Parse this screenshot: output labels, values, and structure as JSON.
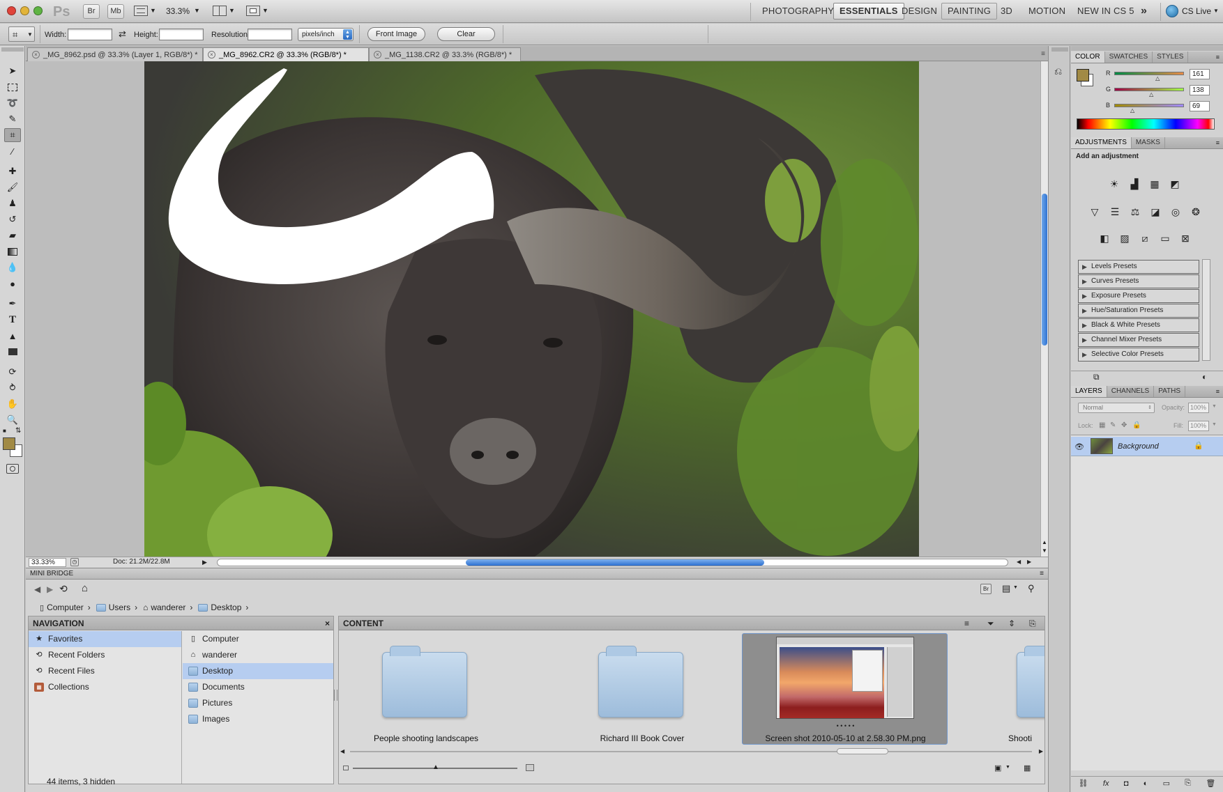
{
  "app": {
    "logo": "Ps",
    "bridge_btn": "Br",
    "minibridge_btn": "Mb",
    "zoom_menu": "33.3%",
    "workspaces": [
      "PHOTOGRAPHY",
      "ESSENTIALS",
      "DESIGN",
      "PAINTING",
      "3D",
      "MOTION",
      "NEW IN CS 5"
    ],
    "active_workspace": "ESSENTIALS",
    "more_glyph": "»",
    "cs_live": "CS Live"
  },
  "options": {
    "width_label": "Width:",
    "height_label": "Height:",
    "resolution_label": "Resolution:",
    "unit_value": "pixels/inch",
    "front_image": "Front Image",
    "clear": "Clear"
  },
  "tabs": [
    {
      "label": "_MG_8962.psd @ 33.3% (Layer 1, RGB/8*) *",
      "active": false
    },
    {
      "label": "_MG_8962.CR2 @ 33.3% (RGB/8*) *",
      "active": true
    },
    {
      "label": "_MG_1138.CR2 @ 33.3% (RGB/8*) *",
      "active": false
    }
  ],
  "status": {
    "zoom": "33.33%",
    "doc": "Doc: 21.2M/22.8M"
  },
  "minibridge": {
    "title": "MINI BRIDGE",
    "breadcrumb": [
      "Computer",
      "Users",
      "wanderer",
      "Desktop"
    ],
    "nav_header": "NAVIGATION",
    "nav_items": [
      "Favorites",
      "Recent Folders",
      "Recent Files",
      "Collections"
    ],
    "places": [
      "Computer",
      "wanderer",
      "Desktop",
      "Documents",
      "Pictures",
      "Images"
    ],
    "content_header": "CONTENT",
    "items": [
      {
        "label": "People shooting landscapes"
      },
      {
        "label": "Richard III Book Cover"
      },
      {
        "label": "Screen shot 2010-05-10 at 2.58.30 PM.png",
        "dots": "• • • • •"
      },
      {
        "label": "Shooti"
      }
    ],
    "footer": "44 items, 3 hidden"
  },
  "color_panel": {
    "tabs": [
      "COLOR",
      "SWATCHES",
      "STYLES"
    ],
    "r_label": "R",
    "g_label": "G",
    "b_label": "B",
    "r": 161,
    "g": 138,
    "b": 69,
    "foreground": "#a18a45"
  },
  "adjustments_panel": {
    "tabs": [
      "ADJUSTMENTS",
      "MASKS"
    ],
    "heading": "Add an adjustment",
    "presets": [
      "Levels Presets",
      "Curves Presets",
      "Exposure Presets",
      "Hue/Saturation Presets",
      "Black & White Presets",
      "Channel Mixer Presets",
      "Selective Color Presets"
    ]
  },
  "layers_panel": {
    "tabs": [
      "LAYERS",
      "CHANNELS",
      "PATHS"
    ],
    "blend_mode": "Normal",
    "opacity_label": "Opacity:",
    "opacity": "100%",
    "lock_label": "Lock:",
    "fill_label": "Fill:",
    "fill": "100%",
    "layer_name": "Background"
  }
}
